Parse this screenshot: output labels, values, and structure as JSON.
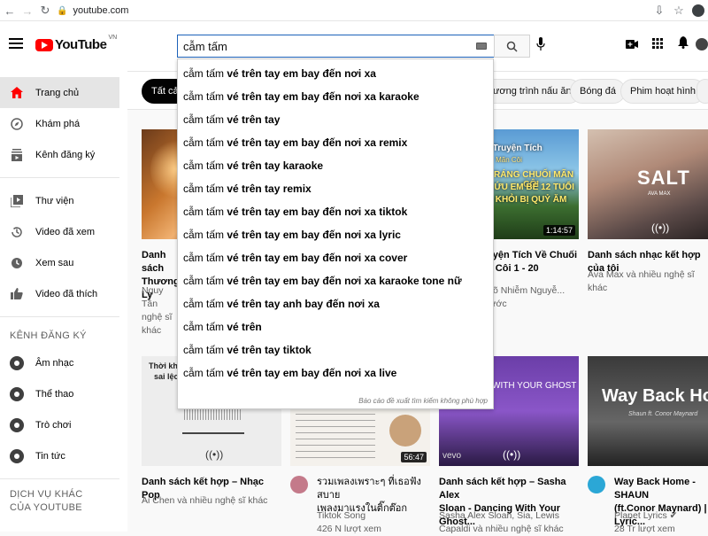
{
  "browser": {
    "url": "youtube.com"
  },
  "masthead": {
    "logo_text": "YouTube",
    "country": "VN",
    "search_value": "cẫm tấm"
  },
  "sidebar": {
    "main": [
      {
        "label": "Trang chủ",
        "icon": "home-icon"
      },
      {
        "label": "Khám phá",
        "icon": "compass-icon"
      },
      {
        "label": "Kênh đăng ký",
        "icon": "subscriptions-icon"
      }
    ],
    "library": [
      {
        "label": "Thư viện",
        "icon": "library-icon"
      },
      {
        "label": "Video đã xem",
        "icon": "history-icon"
      },
      {
        "label": "Xem sau",
        "icon": "clock-icon"
      },
      {
        "label": "Video đã thích",
        "icon": "like-icon"
      }
    ],
    "subs_heading": "KÊNH ĐĂNG KÝ",
    "subs": [
      {
        "label": "Âm nhạc"
      },
      {
        "label": "Thể thao"
      },
      {
        "label": "Trò chơi"
      },
      {
        "label": "Tin tức"
      }
    ],
    "more_heading": "DỊCH VỤ KHÁC CỦA YOUTUBE"
  },
  "chips": [
    "Tất cả",
    "ương trình nấu ăn",
    "Bóng đá",
    "Phim hoạt hình"
  ],
  "search_dropdown": {
    "prefix": "cẫm tấm",
    "suggestions": [
      " vé trên tay em bay đến nơi xa",
      " vé trên tay em bay đến nơi xa karaoke",
      " vé trên tay",
      " vé trên tay em bay đến nơi xa remix",
      " vé trên tay karaoke",
      " vé trên tay remix",
      " vé trên tay em bay đến nơi xa tiktok",
      " vé trên tay em bay đến nơi xa lyric",
      " vé trên tay em bay đến nơi xa cover",
      " vé trên tay em bay đến nơi xa karaoke tone nữ",
      " vé trên tay anh bay đến nơi xa",
      " vé trên",
      " vé trên tay tiktok",
      " vé trên tay em bay đến nơi xa live"
    ],
    "report": "Báo cáo đề xuất tìm kiếm không phù hợp"
  },
  "videos_row1": [
    {
      "title_l1": "Danh sách",
      "title_l2": "Thương Ly",
      "meta_l1": "Nguy Tân",
      "meta_l2": "nghệ sĩ khác",
      "duration": ""
    },
    {
      "title_l1": "uyện Tích Về Chuối",
      "title_l2": "n Côi 1 - 20",
      "meta_l1": "Võ Nhiễm Nguyễ...",
      "meta_l2": "rước",
      "duration": "1:14:57",
      "thumb_text_1": "100 Truyện Tích",
      "thumb_text_2": "Mãn Côi",
      "thumb_text_3": "TRÁNG CHUỐI MÃN CÔI",
      "thumb_text_4": "CỨU EM BÉ 12 TUỔI",
      "thumb_text_5": "KHỎI BỊ QUỶ ĂM"
    },
    {
      "title_l1": "Danh sách nhạc kết hợp của tôi",
      "title_l2": "",
      "meta_l1": "Ava Max và nhiều nghệ sĩ khác",
      "meta_l2": "",
      "duration": "",
      "thumb_text_1": "SALT",
      "thumb_text_2": "AVA MAX"
    }
  ],
  "videos_row2": [
    {
      "title_l1": "Danh sách kết hợp – Nhạc Pop",
      "title_l2": "",
      "meta_l1": "Ai Chen và nhiều nghệ sĩ khác",
      "meta_l2": "",
      "thumb_text_1": "Thời khắc",
      "thumb_text_2": "sai lệch"
    },
    {
      "title_l1": "รวมเพลงเพราะๆ ที่เธอฟังสบาย",
      "title_l2": "เพลงมาแรงในติ๊กต๊อก",
      "meta_l1": "Tiktok Song",
      "meta_l2": "426 N lượt xem",
      "duration": "56:47"
    },
    {
      "title_l1": "Danh sách kết hợp – Sasha Alex",
      "title_l2": "Sloan - Dancing With Your Ghost...",
      "meta_l1": "Sasha Alex Sloan, Sia, Lewis",
      "meta_l2": "Capaldi và nhiều nghệ sĩ khác",
      "thumb_text_1": "WITH YOUR GHOST",
      "thumb_text_2": "vevo"
    },
    {
      "title_l1": "Way Back Home - SHAUN",
      "title_l2": "(ft.Conor Maynard) | Lyric...",
      "meta_l1": "Planet Lyrics ✔",
      "meta_l2": "28 Tr lượt xem",
      "thumb_text_1": "Way Back Home",
      "thumb_text_2": "Shaun ft. Conor Maynard"
    }
  ]
}
